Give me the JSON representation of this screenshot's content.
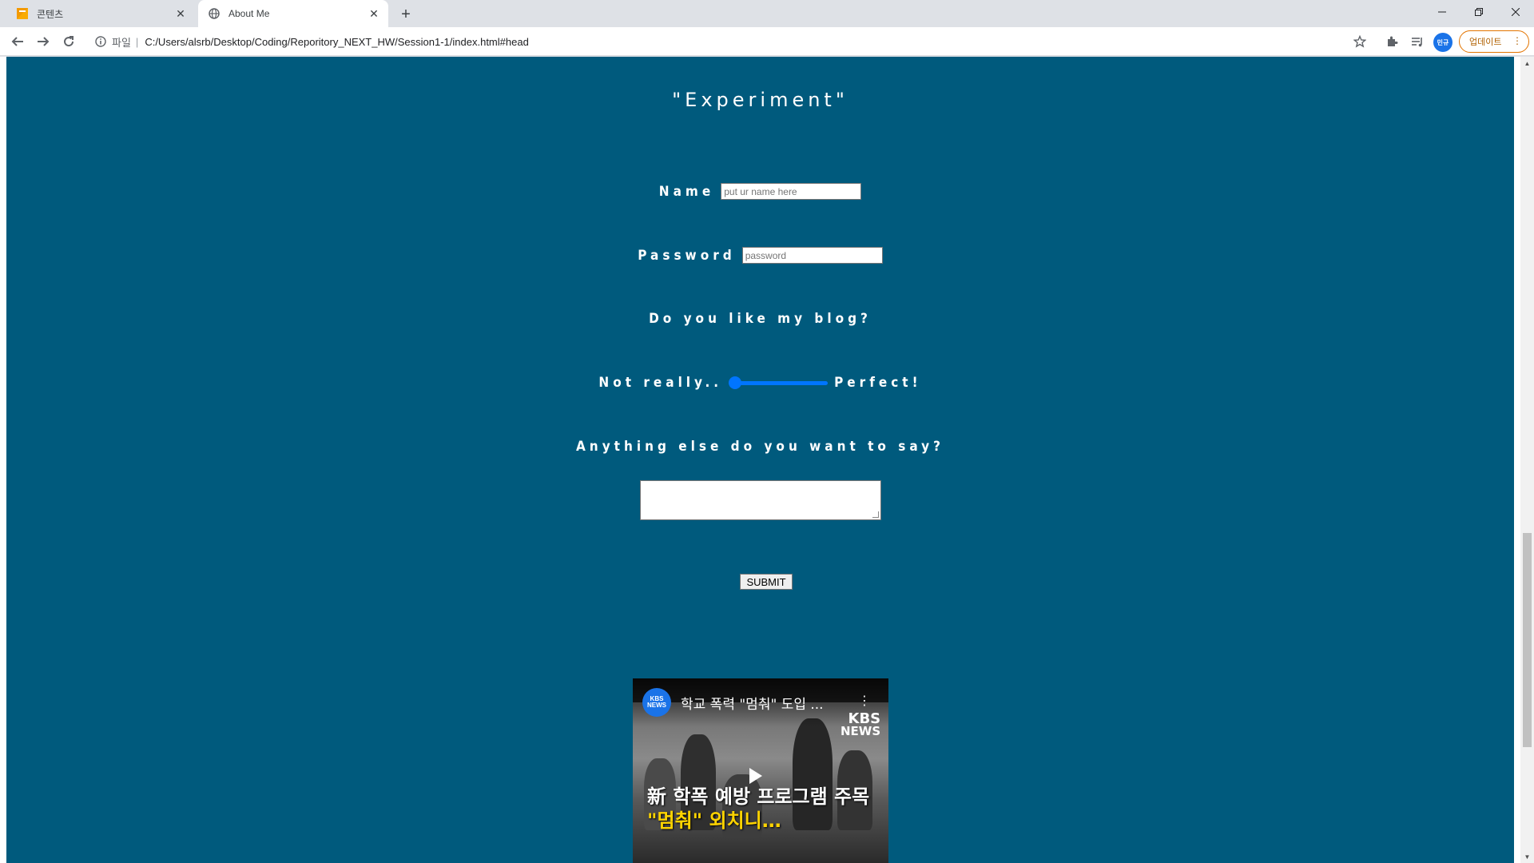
{
  "browser": {
    "tabs": [
      {
        "title": "콘텐츠",
        "active": false
      },
      {
        "title": "About Me",
        "active": true
      }
    ],
    "new_tab_label": "+",
    "omnibox": {
      "scheme_label": "파일",
      "url": "C:/Users/alsrb/Desktop/Coding/Reporitory_NEXT_HW/Session1-1/index.html#head"
    },
    "profile_label": "민규",
    "update_label": "업데이트",
    "colors": {
      "toolbar": "#ffffff",
      "tabstrip": "#dee1e6",
      "update_accent": "#e37400"
    }
  },
  "page": {
    "background": "#005a7d",
    "heading": "\"Experiment\"",
    "form": {
      "name_label": "Name",
      "name_placeholder": "put ur name here",
      "password_label": "Password",
      "password_placeholder": "password",
      "question": "Do you like my blog?",
      "slider_min_label": "Not really..",
      "slider_max_label": "Perfect!",
      "slider_value_fraction": 0,
      "textarea_question": "Anything else do you want to say?",
      "submit_label": "SUBMIT"
    },
    "video": {
      "channel": "KBS NEWS",
      "title": "학교 폭력 \"멈춰\" 도입 ...",
      "logo_line1": "KBS",
      "logo_line2": "NEWS",
      "caption_line1": "新 학폭 예방 프로그램 주목",
      "caption_line2": "\"멈춰\" 외치니…"
    }
  }
}
